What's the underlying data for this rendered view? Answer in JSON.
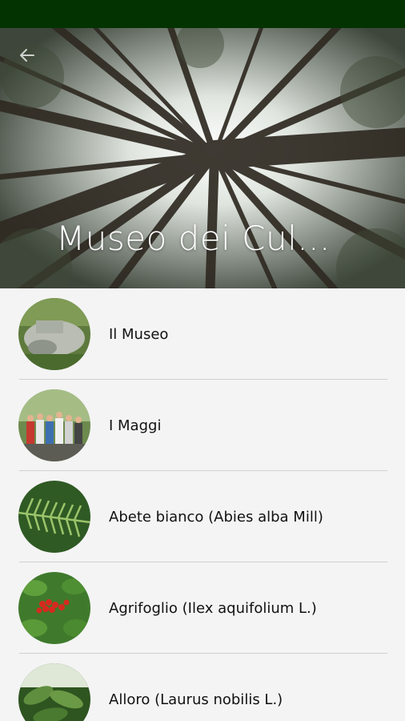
{
  "header": {
    "title": "Museo dei Cul..."
  },
  "items": [
    {
      "label": "Il Museo",
      "thumb": "museum-rock-thumb"
    },
    {
      "label": "I Maggi",
      "thumb": "people-gathering-thumb"
    },
    {
      "label": "Abete bianco (Abies alba Mill)",
      "thumb": "fir-branch-thumb"
    },
    {
      "label": "Agrifoglio (Ilex aquifolium L.)",
      "thumb": "holly-berries-thumb"
    },
    {
      "label": "Alloro (Laurus nobilis L.)",
      "thumb": "laurel-leaves-thumb"
    }
  ],
  "colors": {
    "statusbar": "#023300",
    "background": "#f4f4f4",
    "divider": "#cfcfcf",
    "text": "#111111"
  }
}
